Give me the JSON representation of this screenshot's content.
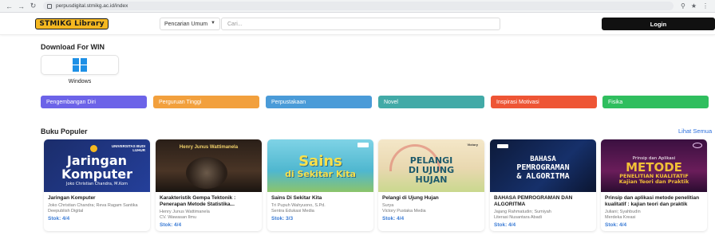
{
  "browser": {
    "url": "perpusdigital.stmikg.ac.id/index"
  },
  "header": {
    "logo_text": "STMIKG Library",
    "search_mode": "Pencarian Umum",
    "search_placeholder": "Cari...",
    "login_label": "Login"
  },
  "download": {
    "title": "Download For WIN",
    "platform_label": "Windows"
  },
  "categories": [
    {
      "label": "Pengembangan Diri",
      "color": "#6c63e8"
    },
    {
      "label": "Perguruan Tinggi",
      "color": "#f2a03d"
    },
    {
      "label": "Perpustakaan",
      "color": "#4a9bd8"
    },
    {
      "label": "Novel",
      "color": "#42aaa7"
    },
    {
      "label": "Inspirasi Motivasi",
      "color": "#ee5535"
    },
    {
      "label": "Fisika",
      "color": "#2fbe5e"
    }
  ],
  "popular": {
    "title": "Buku Populer",
    "see_all": "Lihat Semua"
  },
  "books": [
    {
      "title": "Jaringan Komputer",
      "author": "Joko Christian Chandra; Reva Ragam Santika",
      "publisher": "Deepublish Digital",
      "stock": "Stok: 4/4",
      "cover_line1": "Jaringan",
      "cover_line2": "Komputer",
      "cover_sub": "Joko Christian Chandra, M.Kom",
      "cover_brand": "UNIVERSITAS BUDI LUHUR"
    },
    {
      "title": "Karakteristik Gempa Tektonik : Penerapan Metode Statistika...",
      "author": "Henry Junus Wattimanela",
      "publisher": "CV. Wawasan Ilmu",
      "stock": "Stok: 4/4",
      "cover_line1": "Henry Junus Wattimanela"
    },
    {
      "title": "Sains Di Sekitar Kita",
      "author": "Tri Pupuh Wahyuono, S.Pd.",
      "publisher": "Sentra Edukasi Media",
      "stock": "Stok: 3/3",
      "cover_line1": "Sains",
      "cover_line2": "di Sekitar Kita"
    },
    {
      "title": "Pelangi di Ujung Hujan",
      "author": "Surya",
      "publisher": "Victory Pustaka Media",
      "stock": "Stok: 4/4",
      "cover_line1": "PELANGI",
      "cover_line2": "DI UJUNG",
      "cover_line3": "HUJAN",
      "cover_brand": "Victory"
    },
    {
      "title": "BAHASA PEMROGRAMAN DAN ALGORITMA",
      "author": "Jajang Rahmatudin; Sumiyah",
      "publisher": "Literasi Nusantara Abadi",
      "stock": "Stok: 4/4",
      "cover_line1": "BAHASA",
      "cover_line2": "PEMROGRAMAN",
      "cover_line3": "& ALGORITMA"
    },
    {
      "title": "Prinsip dan aplikasi metode penelitian kualitatif : kajian teori dan praktik",
      "author": "Juliani; Syahbudin",
      "publisher": "Merdeka Kreasi",
      "stock": "Stok: 4/4",
      "cover_line1": "Prinsip dan Aplikasi",
      "cover_line2": "METODE",
      "cover_line3": "PENELITIAN KUALITATIF",
      "cover_line4": "Kajian Teori dan Praktik"
    }
  ]
}
